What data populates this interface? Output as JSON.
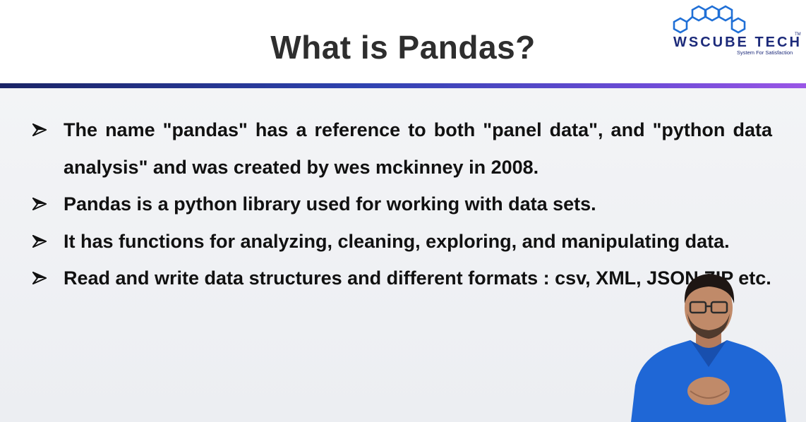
{
  "slide": {
    "title": "What is Pandas?",
    "bullets": [
      "The name \"pandas\" has a reference to both \"panel data\", and \"python data analysis\" and was created by wes mckinney in 2008.",
      "Pandas is a python library used for working with data sets.",
      "It has functions for analyzing, cleaning, exploring, and manipulating data.",
      "Read and write data structures and different formats : csv, XML, JSON,ZIP etc."
    ]
  },
  "logo": {
    "name": "WsCube Tech",
    "name_display": "WSCUBE TECH",
    "tagline": "System For Satisfaction",
    "tm": "TM",
    "color": "#1c2a7a"
  },
  "colors": {
    "divider_start": "#1a2466",
    "divider_end": "#9a56e6",
    "title_color": "#2e2e2e",
    "bullet_text": "#111111",
    "presenter_shirt": "#1f67d6"
  },
  "icons": {
    "bullet": "arrowhead-bullet-icon",
    "logo_mark": "hexagon-cluster-icon"
  }
}
